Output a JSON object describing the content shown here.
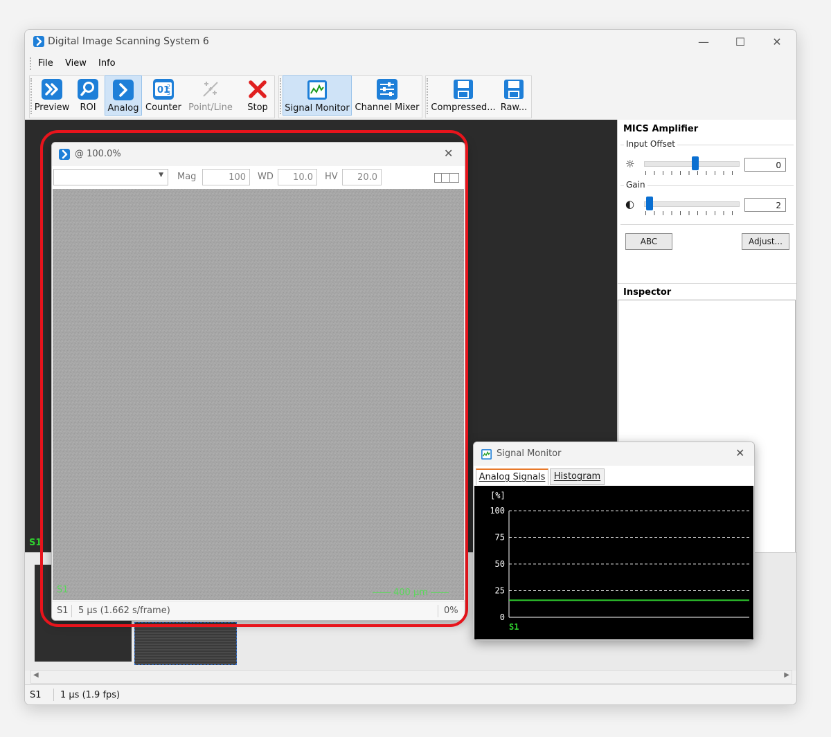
{
  "window": {
    "title": "Digital Image Scanning System 6",
    "controls": {
      "minimize": "—",
      "maximize": "☐",
      "close": "✕"
    }
  },
  "menu": {
    "items": [
      "File",
      "View",
      "Info"
    ]
  },
  "toolbar": {
    "preview": "Preview",
    "roi": "ROI",
    "analog": "Analog",
    "counter": "Counter",
    "point_line": "Point/Line",
    "stop": "Stop",
    "signal_monitor": "Signal Monitor",
    "channel_mixer": "Channel Mixer",
    "compressed": "Compressed...",
    "raw": "Raw...",
    "active": "Analog",
    "accent_color": "#1e7fd8",
    "stop_color": "#e02020"
  },
  "mics": {
    "title": "MICS Amplifier",
    "input_offset_label": "Input Offset",
    "input_offset_value": "0",
    "input_offset_level": 0.55,
    "gain_label": "Gain",
    "gain_value": "2",
    "gain_level": 0.02,
    "abc_label": "ABC",
    "adjust_label": "Adjust..."
  },
  "inspector": {
    "title": "Inspector"
  },
  "image_window": {
    "title": "@ 100.0%",
    "dropdown_value": "",
    "mag_label": "Mag",
    "mag_value": "100",
    "wd_label": "WD",
    "wd_value": "10.0",
    "hv_label": "HV",
    "hv_value": "20.0",
    "overlay_channel": "S1",
    "scale_bar": "400 µm",
    "status_channel": "S1",
    "status_timing": "5 µs (1.662 s/frame)",
    "status_progress": "0%",
    "highlight_color": "#e8141c"
  },
  "workspace": {
    "channel_label": "S1"
  },
  "signal_monitor": {
    "title": "Signal Monitor",
    "tabs": [
      "Analog Signals",
      "Histogram"
    ],
    "active_tab": "Analog Signals",
    "unit_label": "[%]",
    "channel_label": "S1",
    "signal_color": "#2fd02f"
  },
  "chart_data": {
    "type": "line",
    "ylim": [
      0,
      100
    ],
    "yticks": [
      "100",
      "75",
      "50",
      "25",
      "0"
    ],
    "ylabel": "[%]",
    "grid": true,
    "series": [
      {
        "name": "S1",
        "values": [
          16,
          16
        ]
      }
    ]
  },
  "statusbar": {
    "channel": "S1",
    "timing": "1 µs (1.9 fps)"
  }
}
